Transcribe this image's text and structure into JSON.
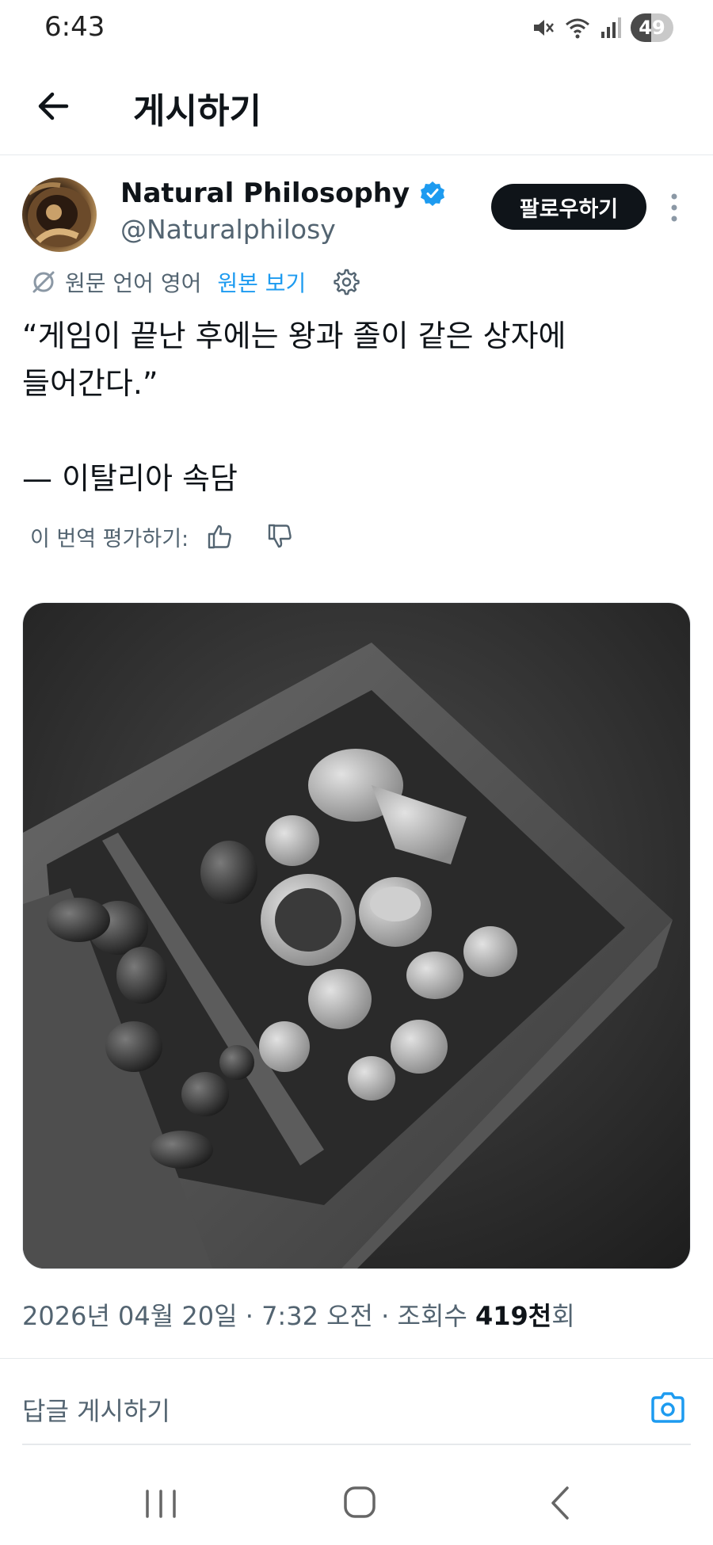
{
  "status_bar": {
    "time": "6:43",
    "battery": "49",
    "battery_level": 0.49
  },
  "header": {
    "title": "게시하기",
    "back_icon": "arrow-left-icon"
  },
  "author": {
    "name": "Natural Philosophy",
    "handle": "@Naturalphilosy",
    "verified": true,
    "follow_label": "팔로우하기",
    "more_icon": "more-vertical-icon"
  },
  "translation": {
    "label": "원문 언어 영어",
    "show_original": "원본 보기",
    "rate_label": "이 번역 평가하기:",
    "accent_color": "#1d9bf0"
  },
  "tweet": {
    "text": "“게임이 끝난 후에는 왕과 졸이 같은 상자에\n들어간다.”",
    "source": "— 이탈리아 속담"
  },
  "meta": {
    "date": "2026년 04월 20일",
    "separator": "·",
    "time": "7:32 오전",
    "views_prefix": "조회수",
    "views_count": "419천",
    "views_suffix": "회"
  },
  "reply": {
    "placeholder": "답글 게시하기",
    "camera_icon": "camera-icon"
  },
  "nav": {
    "recent_icon": "recent-apps-icon",
    "home_icon": "home-icon",
    "back_icon": "back-icon"
  }
}
